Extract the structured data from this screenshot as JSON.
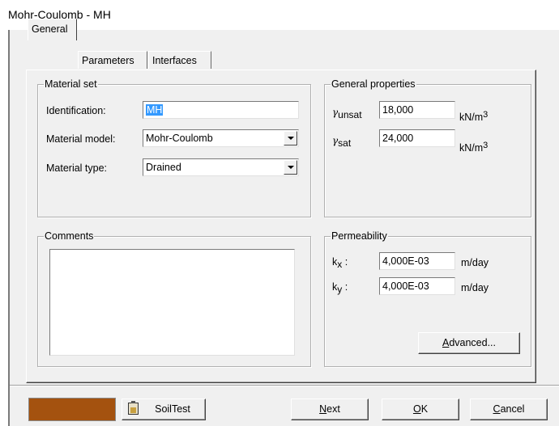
{
  "window": {
    "title": "Mohr-Coulomb - MH"
  },
  "tabs": [
    {
      "label": "General",
      "active": true
    },
    {
      "label": "Parameters",
      "active": false
    },
    {
      "label": "Interfaces",
      "active": false
    }
  ],
  "material_set": {
    "title": "Material set",
    "identification_label": "Identification:",
    "identification_value": "MH",
    "model_label": "Material model:",
    "model_value": "Mohr-Coulomb",
    "type_label": "Material type:",
    "type_value": "Drained"
  },
  "general_properties": {
    "title": "General properties",
    "gamma_symbol": "γ",
    "unsat_sub": "unsat",
    "unsat_value": "18,000",
    "sat_sub": "sat",
    "sat_value": "24,000",
    "unit_base": "kN/m",
    "unit_exp": "3"
  },
  "comments": {
    "title": "Comments",
    "text": ""
  },
  "permeability": {
    "title": "Permeability",
    "k": "k",
    "kx_sub": "x",
    "ky_sub": "y",
    "colon": " :",
    "kx_value": "4,000E-03",
    "ky_value": "4,000E-03",
    "unit": "m/day",
    "advanced_prefix": "A",
    "advanced_rest": "dvanced..."
  },
  "footer": {
    "swatch_color": "#a4520f",
    "soiltest_label": "SoilTest",
    "next_prefix": "N",
    "next_rest": "ext",
    "ok_prefix": "O",
    "ok_rest": "K",
    "cancel_prefix": "C",
    "cancel_rest": "ancel"
  }
}
